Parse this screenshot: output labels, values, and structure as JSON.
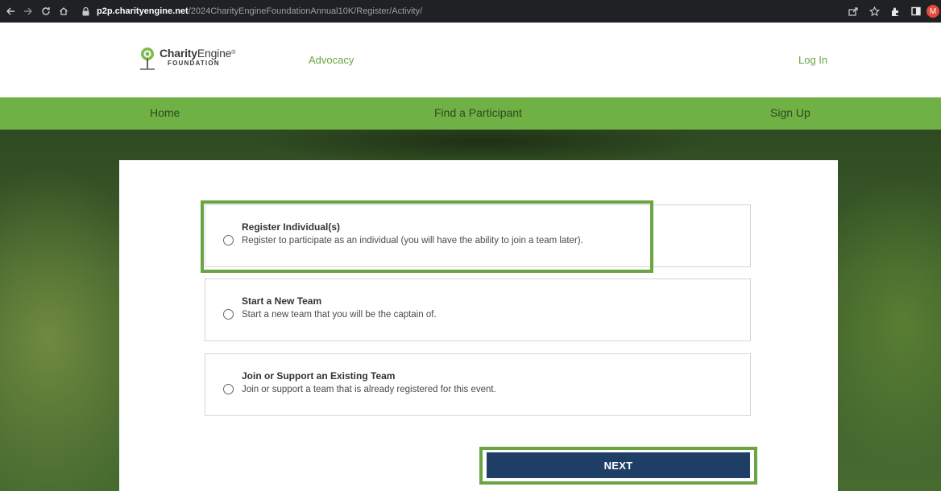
{
  "browser": {
    "url_host": "p2p.charityengine.net",
    "url_path": "/2024CharityEngineFoundationAnnual10K/Register/Activity/",
    "avatar_letter": "M",
    "icons": [
      "back-arrow-icon",
      "forward-arrow-icon",
      "reload-icon",
      "home-icon",
      "lock-icon",
      "share-icon",
      "star-icon",
      "extensions-icon",
      "sidepanel-icon"
    ]
  },
  "header": {
    "logo_name_bold": "Charity",
    "logo_name_regular": "Engine",
    "logo_tm": "®",
    "logo_sub": "FOUNDATION",
    "advocacy_link": "Advocacy",
    "login_link": "Log In"
  },
  "nav": {
    "home": "Home",
    "find": "Find a Participant",
    "signup": "Sign Up"
  },
  "options": [
    {
      "title": "Register Individual(s)",
      "desc": "Register to participate as an individual (you will have the ability to join a team later).",
      "selected": false
    },
    {
      "title": "Start a New Team",
      "desc": "Start a new team that you will be the captain of.",
      "selected": false
    },
    {
      "title": "Join or Support an Existing Team",
      "desc": "Join or support a team that is already registered for this event.",
      "selected": false
    }
  ],
  "next_label": "NEXT",
  "colors": {
    "brand_green": "#6fb145",
    "link_green": "#6aa543",
    "button_navy": "#1e3e66",
    "highlight_green": "#6aa543"
  }
}
